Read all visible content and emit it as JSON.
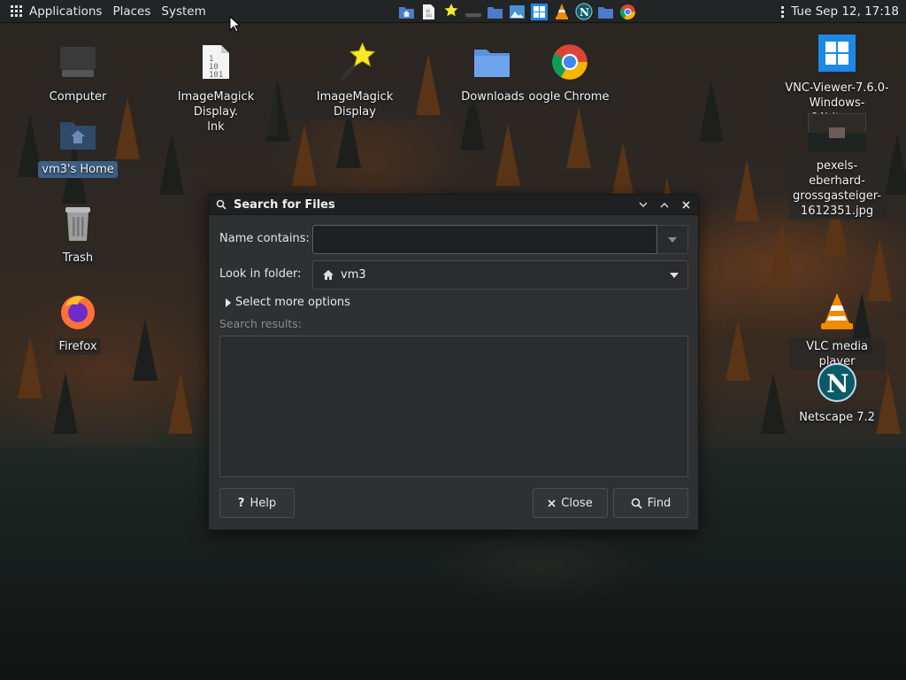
{
  "top_panel": {
    "menus": [
      "Applications",
      "Places",
      "System"
    ],
    "clock": "Tue Sep 12, 17:18",
    "launchers": [
      "home-folder-icon",
      "text-file-icon",
      "imagemagick-icon",
      "computer-icon",
      "folder-icon",
      "image-viewer-icon",
      "windows-icon",
      "vlc-icon",
      "netscape-icon",
      "folder-icon",
      "chrome-icon"
    ]
  },
  "desktop": {
    "left_icons": [
      {
        "label": "Computer",
        "icon": "computer-icon"
      },
      {
        "label": "vm3's Home",
        "icon": "home-folder-icon"
      },
      {
        "label": "Trash",
        "icon": "trash-icon"
      },
      {
        "label": "Firefox",
        "icon": "firefox-icon"
      }
    ],
    "top_icons": [
      {
        "label": "ImageMagick Display.\nlnk",
        "icon": "text-file-icon"
      },
      {
        "label": "ImageMagick Display",
        "icon": "imagemagick-icon"
      },
      {
        "label": "Downloads",
        "icon": "folder-icon"
      },
      {
        "label": "oogle Chrome",
        "icon": "chrome-icon"
      }
    ],
    "right_icons": [
      {
        "label": "VNC-Viewer-7.6.0-\nWindows-64bit.exe",
        "icon": "windows-icon"
      },
      {
        "label": "pexels-eberhard-\ngrossgasteiger-\n1612351.jpg",
        "icon": "image-thumbnail-icon"
      },
      {
        "label": "VLC media player",
        "icon": "vlc-icon"
      },
      {
        "label": "Netscape 7.2",
        "icon": "netscape-icon"
      }
    ]
  },
  "dialog": {
    "title": "Search for Files",
    "name_label": "Name contains:",
    "name_value": "",
    "folder_label": "Look in folder:",
    "folder_value": "vm3",
    "more_options": "Select more options",
    "results_label": "Search results:",
    "help_button": "Help",
    "close_button": "Close",
    "find_button": "Find"
  }
}
